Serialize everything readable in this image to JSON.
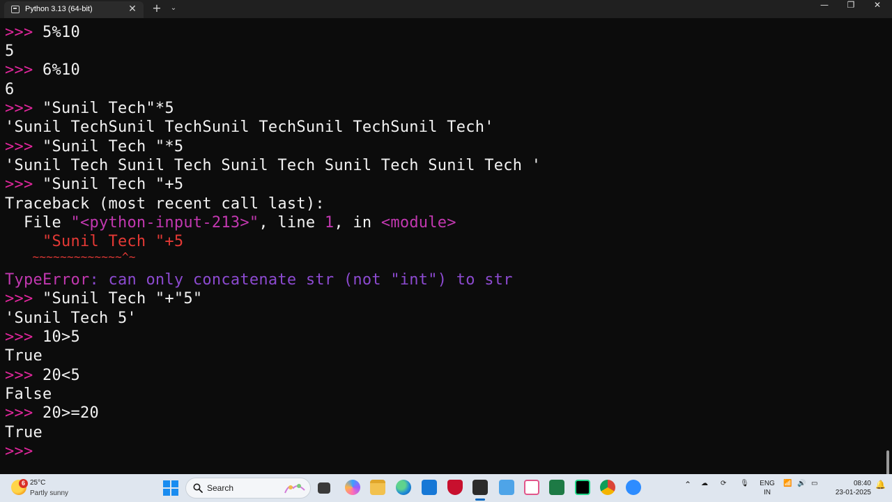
{
  "window": {
    "tab_title": "Python 3.13 (64-bit)",
    "close_glyph": "✕",
    "new_tab_glyph": "+",
    "dropdown_glyph": "⌄",
    "min_glyph": "—",
    "max_glyph": "❐",
    "winclose_glyph": "✕"
  },
  "terminal": {
    "prompt": ">>>",
    "lines": [
      {
        "prompt": ">>>",
        "text": " 5%10"
      },
      {
        "text": "5"
      },
      {
        "prompt": ">>>",
        "text": " 6%10"
      },
      {
        "text": "6"
      },
      {
        "prompt": ">>>",
        "text": " \"Sunil Tech\"*5"
      },
      {
        "text": "'Sunil TechSunil TechSunil TechSunil TechSunil Tech'"
      },
      {
        "prompt": ">>>",
        "text": " \"Sunil Tech \"*5"
      },
      {
        "text": "'Sunil Tech Sunil Tech Sunil Tech Sunil Tech Sunil Tech '"
      },
      {
        "prompt": ">>>",
        "text": " \"Sunil Tech \"+5"
      },
      {
        "text": "Traceback (most recent call last):"
      },
      {
        "file_kw": "  File ",
        "file_name": "\"<python-input-213>\"",
        "sep1": ", line ",
        "line_no": "1",
        "sep2": ", in ",
        "module": "<module>"
      },
      {
        "code_red": "    \"Sunil Tech \"",
        "code_rest": "+5"
      },
      {
        "carets": "    ~~~~~~~~~~~~~^~"
      },
      {
        "err_type": "TypeError",
        "err_msg": ": can only concatenate str (not \"int\") to str"
      },
      {
        "prompt": ">>>",
        "text": " \"Sunil Tech \"+\"5\""
      },
      {
        "text": "'Sunil Tech 5'"
      },
      {
        "prompt": ">>>",
        "text": " 10>5"
      },
      {
        "text": "True"
      },
      {
        "prompt": ">>>",
        "text": " 20<5"
      },
      {
        "text": "False"
      },
      {
        "prompt": ">>>",
        "text": " 20>=20"
      },
      {
        "text": "True"
      },
      {
        "prompt": ">>>",
        "text": ""
      }
    ]
  },
  "taskbar": {
    "weather_badge": "6",
    "weather_temp": "25°C",
    "weather_desc": "Partly sunny",
    "search_label": "Search",
    "lang_top": "ENG",
    "lang_bottom": "IN",
    "time": "08:40",
    "date": "23-01-2025"
  },
  "colors": {
    "prompt": "#e0279c",
    "error": "#e53935",
    "magenta": "#c238b0",
    "terminal_bg": "#0c0c0c",
    "taskbar_bg": "#dfe6ef"
  }
}
